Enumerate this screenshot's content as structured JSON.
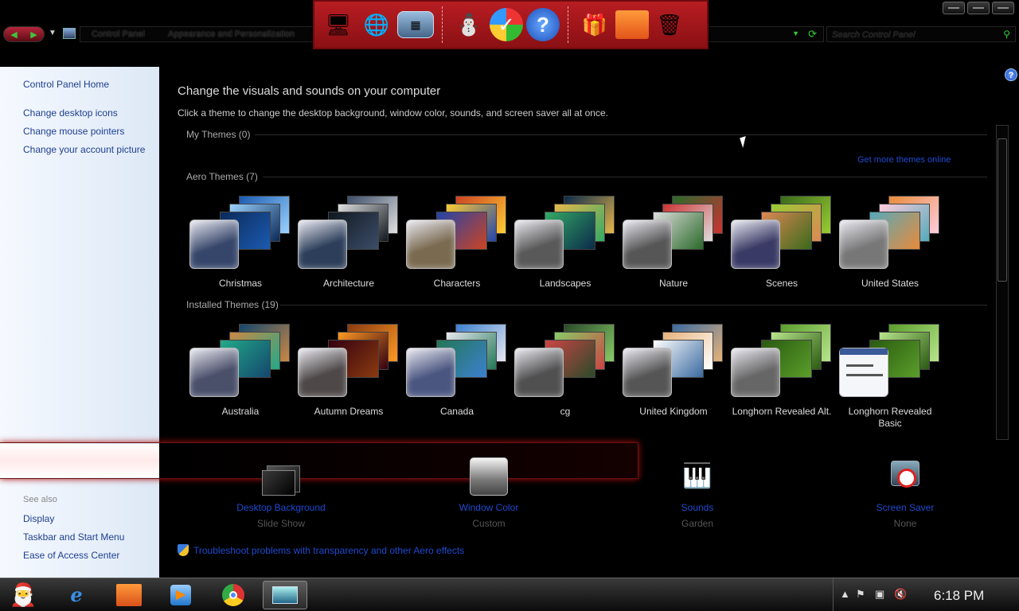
{
  "breadcrumb": {
    "items": [
      "Control Panel",
      "Appearance and Personalization"
    ]
  },
  "search": {
    "placeholder": "Search Control Panel"
  },
  "dock": {
    "icons": [
      "santa-computer-icon",
      "globe-network-icon",
      "network-window-icon",
      "snowman-icon",
      "shield-check-icon",
      "help-icon",
      "gift-box-icon",
      "folder-icon",
      "recycle-bin-icon"
    ]
  },
  "sidebar": {
    "home": "Control Panel Home",
    "links": [
      "Change desktop icons",
      "Change mouse pointers",
      "Change your account picture"
    ],
    "see_also_label": "See also",
    "see_also": [
      "Display",
      "Taskbar and Start Menu",
      "Ease of Access Center"
    ]
  },
  "main": {
    "title": "Change the visuals and sounds on your computer",
    "subtitle": "Click a theme to change the desktop background, window color, sounds, and screen saver all at once.",
    "my_themes": "My Themes (0)",
    "get_more": "Get more themes online",
    "aero_themes": "Aero Themes (7)",
    "installed_themes": "Installed Themes (19)",
    "aero": [
      {
        "name": "Christmas"
      },
      {
        "name": "Architecture"
      },
      {
        "name": "Characters"
      },
      {
        "name": "Landscapes"
      },
      {
        "name": "Nature"
      },
      {
        "name": "Scenes"
      },
      {
        "name": "United States"
      }
    ],
    "installed": [
      {
        "name": "Australia"
      },
      {
        "name": "Autumn Dreams"
      },
      {
        "name": "Canada"
      },
      {
        "name": "cg"
      },
      {
        "name": "United Kingdom"
      },
      {
        "name": "Longhorn Revealed Alt."
      },
      {
        "name": "Longhorn Revealed Basic"
      }
    ]
  },
  "bottom": {
    "desktop_background": {
      "label": "Desktop Background",
      "value": "Slide Show"
    },
    "window_color": {
      "label": "Window Color",
      "value": "Custom"
    },
    "sounds": {
      "label": "Sounds",
      "value": "Garden"
    },
    "screen_saver": {
      "label": "Screen Saver",
      "value": "None"
    }
  },
  "troubleshoot": "Troubleshoot problems with transparency and other Aero effects",
  "taskbar": {
    "apps": [
      "internet-explorer-icon",
      "file-explorer-icon",
      "media-player-icon",
      "chrome-icon",
      "control-panel-icon"
    ],
    "clock": "6:18 PM"
  }
}
